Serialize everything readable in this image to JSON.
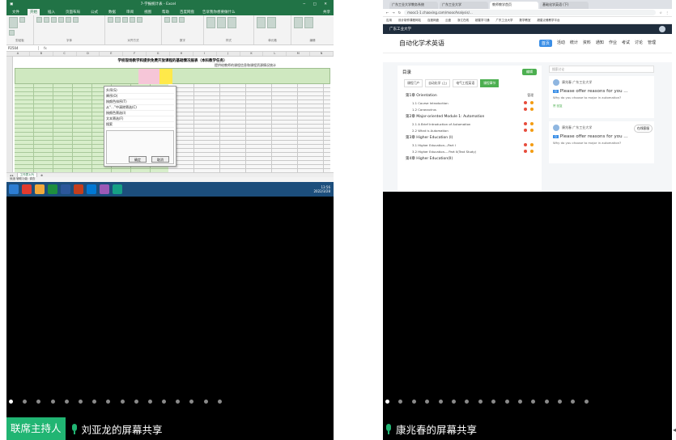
{
  "left_tile": {
    "excel": {
      "window_title": "7-学报统计表 - Excel",
      "tabs": [
        "文件",
        "开始",
        "插入",
        "页面布局",
        "公式",
        "数据",
        "审阅",
        "视图",
        "帮助",
        "百度网盘"
      ],
      "tell_me": "告诉我你想要做什么",
      "share": "共享",
      "ribbon_groups": [
        "剪贴板",
        "字体",
        "对齐方式",
        "数字",
        "样式",
        "单元格",
        "编辑"
      ],
      "name_box": "P2504",
      "fx": "fx",
      "col_letters": [
        "A",
        "B",
        "C",
        "D",
        "E",
        "F",
        "G",
        "H",
        "I",
        "J",
        "K",
        "L",
        "M",
        "N"
      ],
      "sheet_title": "学校现场教学和提供免费开放课程的基础情况报表（本科教学任务）",
      "sub_title": "提供给教师的课程信息和课程资源情况统计",
      "filter_menu": [
        "升序(S)",
        "降序(O)",
        "按颜色排序(T)",
        "从“...”中清除筛选(C)",
        "按颜色筛选(I)",
        "文本筛选(F)",
        "搜索"
      ],
      "filter_ok": "确定",
      "filter_cancel": "取消",
      "sheet_tab": "工作表1(P)",
      "status": "就绪  辅助功能: 调查",
      "clock_time": "13:56",
      "clock_date": "2022/3/28"
    },
    "presenter_badge": "联席主持人",
    "share_label": "刘亚龙的屏幕共享",
    "page_dots": 16,
    "active_dot": 0
  },
  "right_tile": {
    "browser": {
      "tabs": [
        "广东工业大学教务系统",
        "广东工业大学",
        "教师教学首页",
        "基础化学英语 (下)"
      ],
      "url": "mooc1-1.chaoxing.com/moocAnalysis/...",
      "bookmarks": [
        "应用",
        "设计制作课程网站",
        "百度网盘",
        "云盘",
        "浙江在线",
        "超星学习通",
        "广东工业大学",
        "数学教室",
        "超星泛雅教学平台",
        "教师教学平台",
        "示意图"
      ]
    },
    "school": "广东工业大学",
    "course_title": "自动化学术英语",
    "nav": [
      "首页",
      "活动",
      "统计",
      "资料",
      "通知",
      "作业",
      "考试",
      "讨论",
      "管理"
    ],
    "nav_active": 0,
    "catalog_label": "目录",
    "edit_label": "编辑",
    "sub_tabs": [
      "课程门户",
      "自动化学 (上)",
      "电气工程英语",
      "课程章节"
    ],
    "sub_tab_active": 3,
    "chapters": [
      {
        "title": "第1章 Orientation",
        "right": "管理",
        "sections": [
          "1.1 Course Introduction",
          "1.2 Coronavirus"
        ]
      },
      {
        "title": "第2章 Major-oriented Module 1: Automation",
        "right": "",
        "sections": [
          "2.1 A Brief Introduction of Automation",
          "2.2 What is Automation"
        ]
      },
      {
        "title": "第3章 Higher Education (I)",
        "right": "",
        "sections": [
          "3.1 Higher Education---Part I",
          "3.2 Higher Education--- Part II(Text Study)"
        ]
      },
      {
        "title": "第4章 Higher Education(II)",
        "right": "",
        "sections": []
      }
    ],
    "search_placeholder": "搜索讨论",
    "posts": [
      {
        "author": "康兆春  广东工业大学",
        "tag": "Q",
        "question": "Please offer reasons for you ...",
        "sub": "Why do you choose to major in automation?",
        "meta": "赞  回复"
      },
      {
        "author": "康兆春  广东工业大学",
        "tag": "Q",
        "question": "Please offer reasons for you ...",
        "sub": "Why do you choose to major in automation?",
        "meta": ""
      }
    ],
    "online_label": "在线客服",
    "share_label": "康兆春的屏幕共享",
    "page_dots": 16,
    "active_dot": 0
  },
  "corner_mark": "◂",
  "colors": {
    "excel_green": "#217346",
    "host_badge": "#21b573",
    "course_nav_active": "#3a8ee6"
  }
}
